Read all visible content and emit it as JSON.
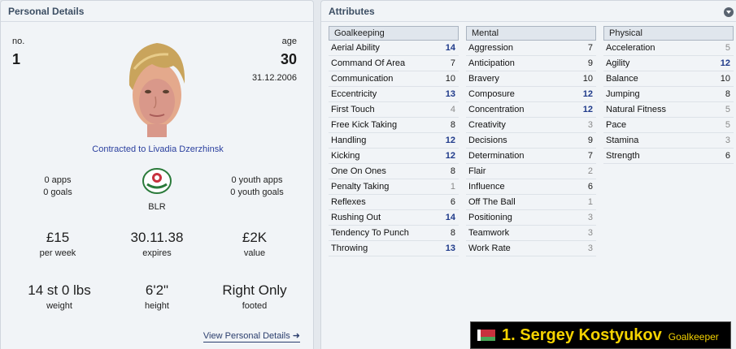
{
  "personal": {
    "title": "Personal Details",
    "number_label": "no.",
    "number": "1",
    "age_label": "age",
    "age": "30",
    "dob": "31.12.2006",
    "contract": "Contracted to Livadia Dzerzhinsk",
    "apps": "0 apps",
    "goals": "0 goals",
    "nation": "BLR",
    "youth_apps": "0 youth apps",
    "youth_goals": "0 youth goals",
    "wage": "£15",
    "wage_label": "per week",
    "expires": "30.11.38",
    "expires_label": "expires",
    "value": "£2K",
    "value_label": "value",
    "weight": "14 st 0 lbs",
    "weight_label": "weight",
    "height": "6'2\"",
    "height_label": "height",
    "footed": "Right Only",
    "footed_label": "footed",
    "view_link": "View Personal Details"
  },
  "attributes": {
    "title": "Attributes",
    "goalkeeping": {
      "header": "Goalkeeping",
      "rows": [
        {
          "name": "Aerial Ability",
          "value": "14"
        },
        {
          "name": "Command Of Area",
          "value": "7"
        },
        {
          "name": "Communication",
          "value": "10"
        },
        {
          "name": "Eccentricity",
          "value": "13"
        },
        {
          "name": "First Touch",
          "value": "4"
        },
        {
          "name": "Free Kick Taking",
          "value": "8"
        },
        {
          "name": "Handling",
          "value": "12"
        },
        {
          "name": "Kicking",
          "value": "12"
        },
        {
          "name": "One On Ones",
          "value": "8"
        },
        {
          "name": "Penalty Taking",
          "value": "1"
        },
        {
          "name": "Reflexes",
          "value": "6"
        },
        {
          "name": "Rushing Out",
          "value": "14"
        },
        {
          "name": "Tendency To Punch",
          "value": "8"
        },
        {
          "name": "Throwing",
          "value": "13"
        }
      ]
    },
    "mental": {
      "header": "Mental",
      "rows": [
        {
          "name": "Aggression",
          "value": "7"
        },
        {
          "name": "Anticipation",
          "value": "9"
        },
        {
          "name": "Bravery",
          "value": "10"
        },
        {
          "name": "Composure",
          "value": "12"
        },
        {
          "name": "Concentration",
          "value": "12"
        },
        {
          "name": "Creativity",
          "value": "3"
        },
        {
          "name": "Decisions",
          "value": "9"
        },
        {
          "name": "Determination",
          "value": "7"
        },
        {
          "name": "Flair",
          "value": "2"
        },
        {
          "name": "Influence",
          "value": "6"
        },
        {
          "name": "Off The Ball",
          "value": "1"
        },
        {
          "name": "Positioning",
          "value": "3"
        },
        {
          "name": "Teamwork",
          "value": "3"
        },
        {
          "name": "Work Rate",
          "value": "3"
        }
      ]
    },
    "physical": {
      "header": "Physical",
      "rows": [
        {
          "name": "Acceleration",
          "value": "5"
        },
        {
          "name": "Agility",
          "value": "12"
        },
        {
          "name": "Balance",
          "value": "10"
        },
        {
          "name": "Jumping",
          "value": "8"
        },
        {
          "name": "Natural Fitness",
          "value": "5"
        },
        {
          "name": "Pace",
          "value": "5"
        },
        {
          "name": "Stamina",
          "value": "3"
        },
        {
          "name": "Strength",
          "value": "6"
        }
      ]
    }
  },
  "player_bar": {
    "name": "1. Sergey Kostyukov",
    "position": "Goalkeeper",
    "flag_colors": [
      "#c8313e",
      "#4aa657"
    ]
  }
}
